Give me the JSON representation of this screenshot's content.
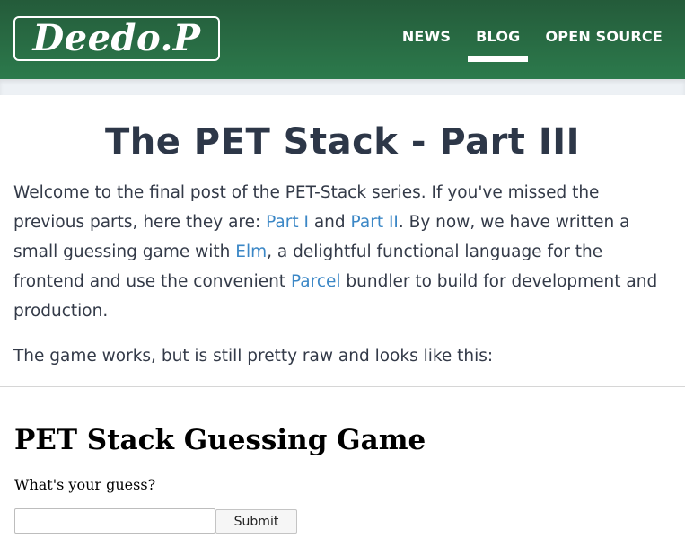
{
  "header": {
    "logo_text": "Deedo.P",
    "nav": [
      {
        "label": "NEWS",
        "active": false
      },
      {
        "label": "BLOG",
        "active": true
      },
      {
        "label": "OPEN SOURCE",
        "active": false
      }
    ],
    "colors": {
      "header_bg_top": "#245b3a",
      "header_bg_bottom": "#2c7a4c",
      "link": "#3b87c6"
    }
  },
  "article": {
    "title": "The PET Stack - Part III",
    "p1": {
      "t1": "Welcome to the final post of the PET-Stack series. If you've missed the previous parts, here they are: ",
      "link1": "Part I",
      "t2": " and ",
      "link2": "Part II",
      "t3": ". By now, we have written a small guessing game with ",
      "link3": "Elm",
      "t4": ", a delightful functional language for the frontend and use the convenient ",
      "link4": "Parcel",
      "t5": " bundler to build for development and production."
    },
    "p2": "The game works, but is still pretty raw and looks like this:"
  },
  "game": {
    "title": "PET Stack Guessing Game",
    "prompt": "What's your guess?",
    "input_value": "",
    "submit_label": "Submit"
  }
}
